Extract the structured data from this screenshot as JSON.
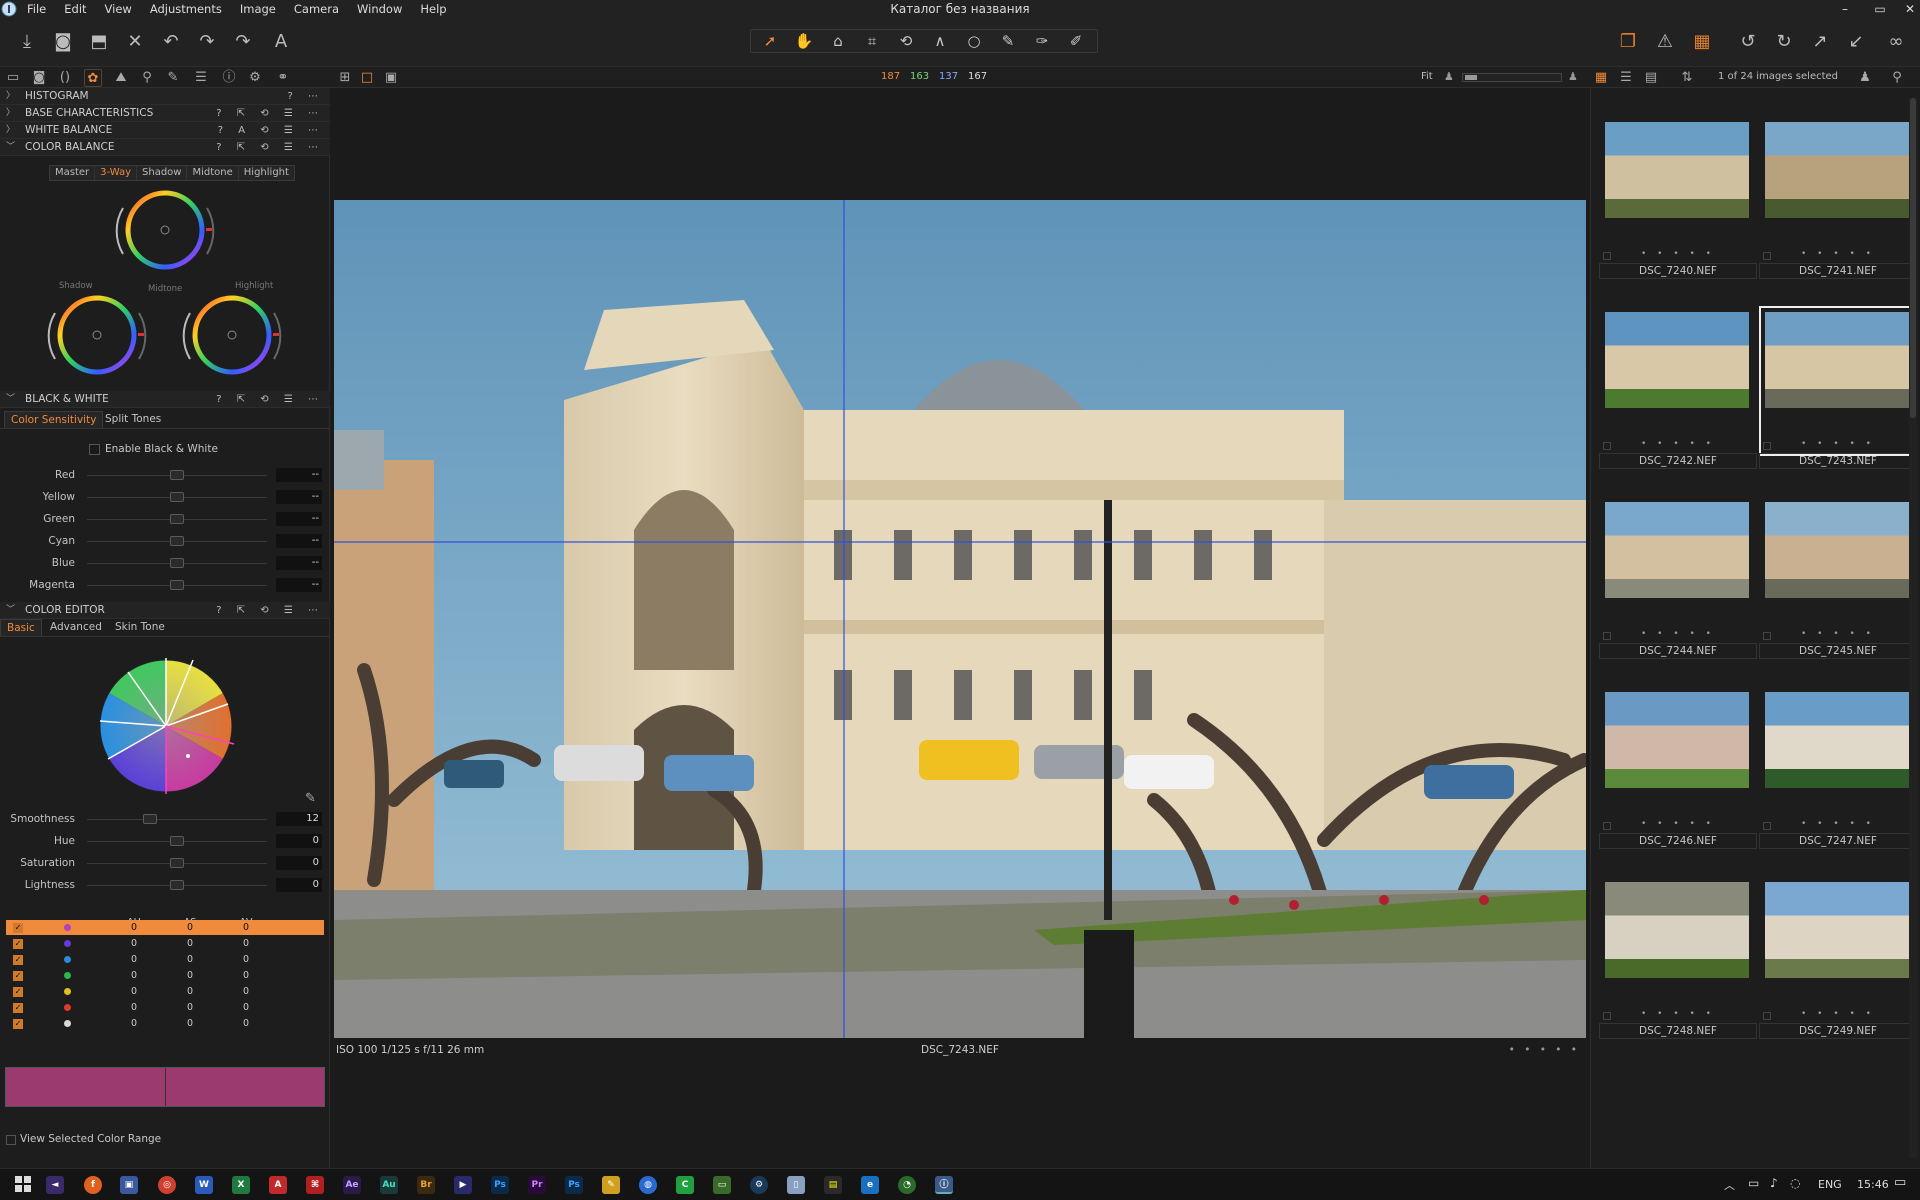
{
  "menu": {
    "items": [
      "File",
      "Edit",
      "View",
      "Adjustments",
      "Image",
      "Camera",
      "Window",
      "Help"
    ]
  },
  "window": {
    "title": "Каталог без названия"
  },
  "viewer_header": {
    "r": "187",
    "g": "163",
    "b": "137",
    "l": "167",
    "fit": "Fit"
  },
  "browser_header": {
    "selection": "1 of 24 images selected"
  },
  "left": {
    "sections": {
      "histogram": "HISTOGRAM",
      "base": "BASE CHARACTERISTICS",
      "white_balance": "WHITE BALANCE",
      "color_balance": "COLOR BALANCE",
      "black_white": "BLACK & WHITE",
      "color_editor": "COLOR EDITOR"
    },
    "color_balance": {
      "tabs": [
        "Master",
        "3-Way",
        "Shadow",
        "Midtone",
        "Highlight"
      ],
      "labels": {
        "shadow": "Shadow",
        "midtone": "Midtone",
        "highlight": "Highlight"
      }
    },
    "bw": {
      "tabs": [
        "Color Sensitivity",
        "Split Tones"
      ],
      "enable": "Enable Black & White",
      "sliders": [
        {
          "label": "Red",
          "value": "--"
        },
        {
          "label": "Yellow",
          "value": "--"
        },
        {
          "label": "Green",
          "value": "--"
        },
        {
          "label": "Cyan",
          "value": "--"
        },
        {
          "label": "Blue",
          "value": "--"
        },
        {
          "label": "Magenta",
          "value": "--"
        }
      ]
    },
    "color_editor": {
      "tabs": [
        "Basic",
        "Advanced",
        "Skin Tone"
      ],
      "sliders": [
        {
          "label": "Smoothness",
          "value": "12",
          "position": 0.35
        },
        {
          "label": "Hue",
          "value": "0",
          "position": 0.5
        },
        {
          "label": "Saturation",
          "value": "0",
          "position": 0.5
        },
        {
          "label": "Lightness",
          "value": "0",
          "position": 0.5
        }
      ],
      "headers": [
        "ΔH",
        "ΔS",
        "ΔV"
      ],
      "rows": [
        {
          "color": "#b040c0",
          "h": "0",
          "s": "0",
          "v": "0",
          "selected": true
        },
        {
          "color": "#6a3ad8",
          "h": "0",
          "s": "0",
          "v": "0"
        },
        {
          "color": "#2a8ae0",
          "h": "0",
          "s": "0",
          "v": "0"
        },
        {
          "color": "#2ab84a",
          "h": "0",
          "s": "0",
          "v": "0"
        },
        {
          "color": "#e0c020",
          "h": "0",
          "s": "0",
          "v": "0"
        },
        {
          "color": "#e03a2a",
          "h": "0",
          "s": "0",
          "v": "0"
        },
        {
          "color": "#d8d8d8",
          "h": "0",
          "s": "0",
          "v": "0"
        }
      ],
      "view_range": "View Selected Color Range",
      "range_color": "#9b3a6e"
    }
  },
  "photo": {
    "info_left": "ISO 100  1/125 s  f/11  26 mm",
    "filename": "DSC_7243.NEF",
    "stars": "• • • • •"
  },
  "thumbnails": [
    {
      "name": "DSC_7240.NEF",
      "stars": "• • • • •"
    },
    {
      "name": "DSC_7241.NEF",
      "stars": "• • • • •"
    },
    {
      "name": "DSC_7242.NEF",
      "stars": "• • • • •"
    },
    {
      "name": "DSC_7243.NEF",
      "stars": "• • • • •",
      "selected": true
    },
    {
      "name": "DSC_7244.NEF",
      "stars": "• • • • •"
    },
    {
      "name": "DSC_7245.NEF",
      "stars": "• • • • •"
    },
    {
      "name": "DSC_7246.NEF",
      "stars": "• • • • •"
    },
    {
      "name": "DSC_7247.NEF",
      "stars": "• • • • •"
    },
    {
      "name": "DSC_7248.NEF",
      "stars": "• • • • •"
    },
    {
      "name": "DSC_7249.NEF",
      "stars": "• • • • •"
    }
  ],
  "taskbar": {
    "lang": "ENG",
    "time": "15:46"
  },
  "colors": {
    "accent": "#f08a3c",
    "panel": "#1d1d1d",
    "guide": "#3050e0"
  }
}
